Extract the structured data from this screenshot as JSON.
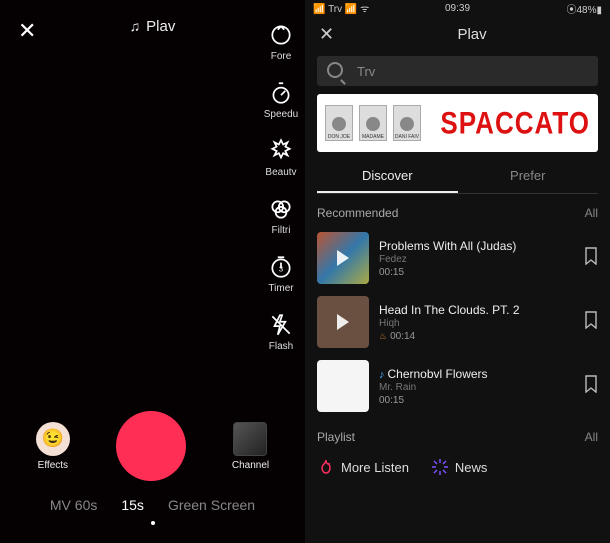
{
  "left": {
    "play_label": "Plav",
    "tools": {
      "fore": "Fore",
      "speed": "Speedu",
      "beauty": "Beautv",
      "filters": "Filtri",
      "timer": "Timer",
      "flash": "Flash"
    },
    "effects_label": "Effects",
    "channel_label": "Channel",
    "modes": {
      "mv60": "MV 60s",
      "m15": "15s",
      "green": "Green Screen"
    }
  },
  "right": {
    "status": {
      "carrier": "Trv",
      "time": "09:39",
      "battery": "48%"
    },
    "title": "Plav",
    "search_placeholder": "Trv",
    "banner": {
      "artists": [
        "DON JOE",
        "MADAME",
        "DANI FAIV"
      ],
      "title": "SPACCATO"
    },
    "tabs": {
      "discover": "Discover",
      "prefer": "Prefer"
    },
    "recommended_label": "Recommended",
    "all_label": "All",
    "tracks": [
      {
        "title": "Problems With All (Judas)",
        "artist": "Fedez",
        "duration": "00:15"
      },
      {
        "title": "Head In The Clouds. PT. 2",
        "artist": "Hiqh",
        "duration": "00:14",
        "fire": true
      },
      {
        "title": "Chernobvl Flowers",
        "artist": "Mr. Rain",
        "duration": "00:15",
        "note": true
      }
    ],
    "playlist_label": "Playlist",
    "playlists": {
      "more": "More Listen",
      "news": "News"
    }
  }
}
